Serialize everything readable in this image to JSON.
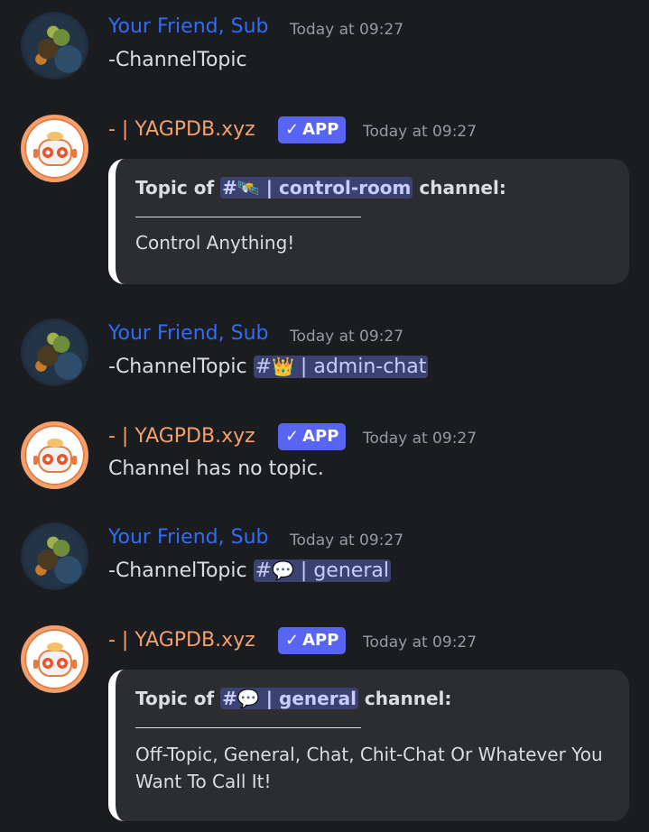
{
  "messages": [
    {
      "author": "Your Friend, Sub",
      "time": "Today at 09:27",
      "text": "-ChannelTopic"
    },
    {
      "author": "- | YAGPDB.xyz",
      "badge": "APP",
      "badge_check": "✓",
      "time": "Today at 09:27",
      "embed": {
        "title_prefix": "Topic of",
        "channel_hash": "#",
        "channel_emoji": "🛰️",
        "channel_name": " | control-room",
        "title_suffix": "channel:",
        "description": "Control Anything!"
      }
    },
    {
      "author": "Your Friend, Sub",
      "time": "Today at 09:27",
      "text": "-ChannelTopic",
      "mention_hash": "#",
      "mention_emoji": "👑",
      "mention_name": " | admin-chat"
    },
    {
      "author": "- | YAGPDB.xyz",
      "badge": "APP",
      "badge_check": "✓",
      "time": "Today at 09:27",
      "text": "Channel has no topic."
    },
    {
      "author": "Your Friend, Sub",
      "time": "Today at 09:27",
      "text": "-ChannelTopic",
      "mention_hash": "#",
      "mention_emoji": "💬",
      "mention_name": " | general"
    },
    {
      "author": "- | YAGPDB.xyz",
      "badge": "APP",
      "badge_check": "✓",
      "time": "Today at 09:27",
      "embed": {
        "title_prefix": "Topic of",
        "channel_hash": "#",
        "channel_emoji": "💬",
        "channel_name": " | general",
        "title_suffix": "channel:",
        "description": "Off-Topic, General, Chat, Chit-Chat Or Whatever You Want To Call It!"
      }
    }
  ],
  "colors": {
    "background": "#1b1c20",
    "user_name": "#2f6df6",
    "bot_name": "#f3a06b",
    "app_badge": "#5865f2",
    "embed_bg": "#2b2d31",
    "mention_bg": "#3c4270"
  },
  "icons": {
    "user_avatar": "avatar-icon",
    "bot_avatar": "robot-face-icon",
    "verified": "checkmark-icon"
  }
}
